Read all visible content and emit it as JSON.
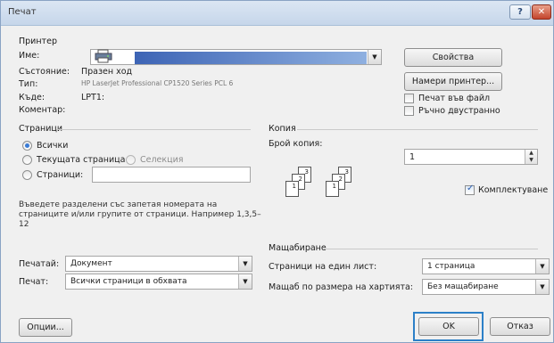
{
  "window": {
    "title": "Печат",
    "help_label": "?",
    "close_label": "✕"
  },
  "printer": {
    "group_title": "Принтер",
    "name_label": "Име:",
    "status_label": "Състояние:",
    "status_value": "Празен ход",
    "type_label": "Тип:",
    "type_value": "HP LaserJet Professional CP1520 Series PCL 6",
    "where_label": "Къде:",
    "where_value": "LPT1:",
    "comment_label": "Коментар:",
    "properties_button": "Свойства",
    "find_printer_button": "Намери принтер...",
    "print_to_file_label": "Печат във файл",
    "print_to_file_checked": false,
    "manual_duplex_label": "Ръчно двустранно",
    "manual_duplex_checked": false
  },
  "pages": {
    "group_title": "Страници",
    "all_label": "Всички",
    "current_label": "Текущата страница",
    "selection_label": "Селекция",
    "pages_label": "Страници:",
    "pages_value": "",
    "selected": "all",
    "hint": "Въведете разделени със запетая номерата на страниците и/или групите от страници. Например 1,3,5–12"
  },
  "copies": {
    "group_title": "Копия",
    "count_label": "Брой копия:",
    "count_value": "1",
    "collate_label": "Комплектуване",
    "collate_checked": true,
    "page_icons": [
      "3",
      "2",
      "1",
      "3",
      "2",
      "1"
    ]
  },
  "print_what": {
    "label": "Печатай:",
    "value": "Документ"
  },
  "print_range": {
    "label": "Печат:",
    "value": "Всички страници в обхвата"
  },
  "zoom": {
    "group_title": "Мащабиране",
    "pages_per_sheet_label": "Страници на един лист:",
    "pages_per_sheet_value": "1 страница",
    "scale_label": "Мащаб по размера на хартията:",
    "scale_value": "Без мащабиране"
  },
  "footer": {
    "options_button": "Опции...",
    "ok_button": "OK",
    "cancel_button": "Отказ"
  }
}
